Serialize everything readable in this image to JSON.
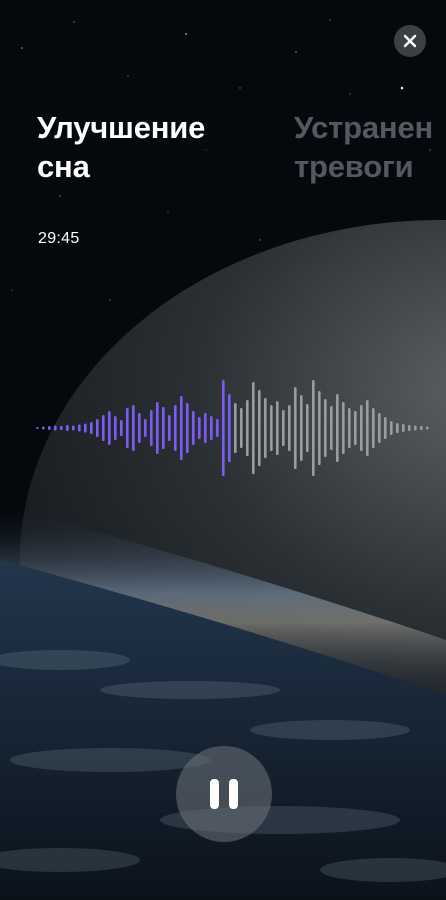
{
  "player": {
    "tracks": [
      {
        "title_line1": "Улучшение",
        "title_line2": "сна",
        "active": true
      },
      {
        "title_line1": "Устранен",
        "title_line2": "тревоги",
        "active": false
      }
    ],
    "time_remaining": "29:45",
    "progress": 0.5,
    "state": "playing"
  },
  "controls": {
    "close_icon": "close-icon",
    "pause_icon": "pause-icon"
  },
  "colors": {
    "waveform_played": "#7c5cf5",
    "waveform_remaining": "#9a9ca0",
    "title_active": "#ffffff",
    "title_inactive": "#6b7079",
    "button_bg": "#5f646c"
  }
}
